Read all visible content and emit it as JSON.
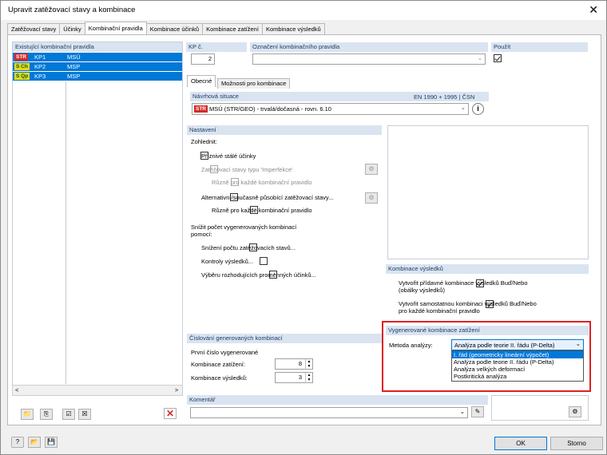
{
  "window": {
    "title": "Upravit zatěžovací stavy a kombinace"
  },
  "tabs": [
    "Zatěžovací stavy",
    "Účinky",
    "Kombinační pravidla",
    "Kombinace účinků",
    "Kombinace zatížení",
    "Kombinace výsledků"
  ],
  "left": {
    "header": "Existující kombinační pravidla",
    "rows": [
      {
        "badge": "STR",
        "id": "KP1",
        "name": "MSÚ"
      },
      {
        "badge": "S Ch",
        "id": "KP2",
        "name": "MSP"
      },
      {
        "badge": "S Qp",
        "id": "KP3",
        "name": "MSP"
      }
    ]
  },
  "top": {
    "kp_label": "KP č.",
    "kp_value": "2",
    "oznaceni_label": "Označení kombinačního pravidla",
    "oznaceni_value": "",
    "pouzit_label": "Použít"
  },
  "inner_tabs": [
    "Obecné",
    "Možnosti pro kombinace"
  ],
  "navrh": {
    "header": "Návrhová situace",
    "norm": "EN 1990 + 1995 | ČSN",
    "badge": "STR",
    "value": "MSÚ (STR/GEO) - trvalá/dočasná - rovn. 6.10"
  },
  "nastaveni": {
    "header": "Nastavení",
    "zohlednit": "Zohlednit:",
    "priznive": "Příznivé stálé účinky",
    "imperfekce": "Zatěžovací stavy typu 'Imperfekce'",
    "ruzne1": "Různě pro každé kombinační pravidlo",
    "alternativni": "Alternativní/současně působící zatěžovací stavy...",
    "ruzne2": "Různě pro každé kombinační pravidlo",
    "snizit": "Snížit počet vygenerovaných kombinací pomocí:",
    "snizeni": "Snížení počtu zatěžovacích stavů...",
    "kontroly": "Kontroly výsledků...",
    "vyberu": "Výběru rozhodujících proměnných účinků..."
  },
  "kombinace_vysledku": {
    "header": "Kombinace výsledků",
    "opt1": "Vytvořit přídavné kombinace výsledků Buď/Nebo",
    "opt1b": "(obálky výsledků)",
    "opt2": "Vytvořit samostatnou kombinaci výsledků Buď/Nebo",
    "opt2b": "pro každé kombinační pravidlo"
  },
  "vygenerovane": {
    "header": "Vygenerované kombinace zatížení",
    "metoda_label": "Metoda analýzy:",
    "metoda_value": "Analýza podle teorie II. řádu (P-Delta)",
    "options": [
      "I. řád (geometricky lineární výpočet)",
      "Analýza podle teorie II. řádu (P-Delta)",
      "Analýza velkých deformací",
      "Postkritická analýza"
    ]
  },
  "cislovani": {
    "header": "Číslování generovaných kombinací",
    "prvni": "První číslo vygenerované",
    "kz_label": "Kombinace zatížení:",
    "kz_value": "8",
    "kv_label": "Kombinace výsledků:",
    "kv_value": "3"
  },
  "komentar": {
    "header": "Komentář",
    "value": ""
  },
  "buttons": {
    "ok": "OK",
    "storno": "Storno"
  }
}
